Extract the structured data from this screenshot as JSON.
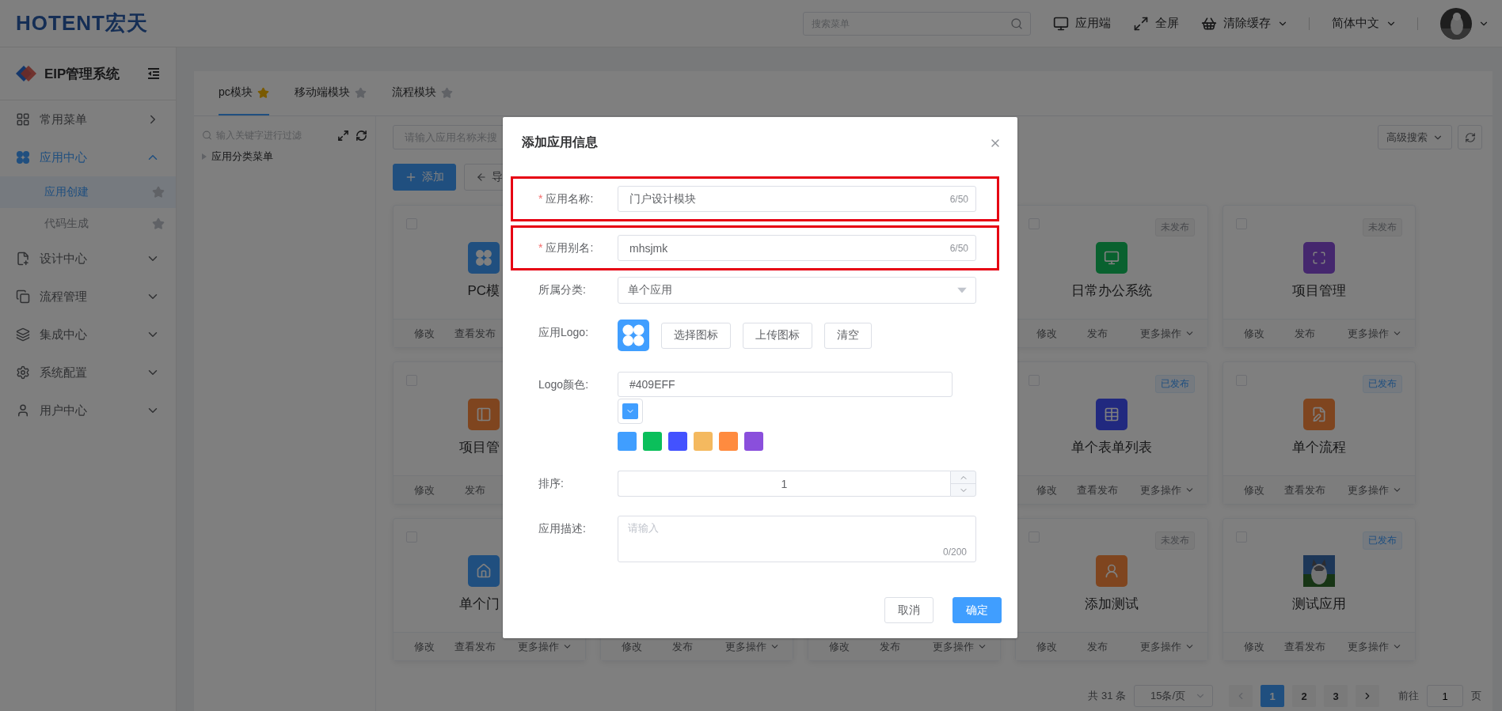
{
  "header": {
    "logo": "HOTENT宏天",
    "search": {
      "placeholder": "搜索菜单"
    },
    "actions": [
      {
        "label": "应用端",
        "dropdown": false
      },
      {
        "label": "全屏",
        "dropdown": false
      },
      {
        "label": "清除缓存",
        "dropdown": true
      }
    ],
    "language": "简体中文"
  },
  "sidebar": {
    "title": "EIP管理系统",
    "items": [
      {
        "label": "常用菜单",
        "kind": "flyout",
        "expanded": false
      },
      {
        "label": "应用中心",
        "kind": "group",
        "expanded": true,
        "children": [
          {
            "label": "应用创建",
            "selected": true
          },
          {
            "label": "代码生成",
            "selected": false
          }
        ]
      },
      {
        "label": "设计中心",
        "kind": "group",
        "expanded": false
      },
      {
        "label": "流程管理",
        "kind": "group",
        "expanded": false
      },
      {
        "label": "集成中心",
        "kind": "group",
        "expanded": false
      },
      {
        "label": "系统配置",
        "kind": "group",
        "expanded": false
      },
      {
        "label": "用户中心",
        "kind": "group",
        "expanded": false
      }
    ]
  },
  "tabs": [
    {
      "label": "pc模块",
      "selected": true,
      "starred": true
    },
    {
      "label": "移动端模块",
      "selected": false,
      "starred": false
    },
    {
      "label": "流程模块",
      "selected": false,
      "starred": false
    }
  ],
  "tree": {
    "filter_placeholder": "输入关键字进行过滤",
    "items": [
      {
        "label": "应用分类菜单",
        "expanded": false
      }
    ]
  },
  "toolbar": {
    "search_placeholder": "请输入应用名称来搜",
    "add_button": "添加",
    "import_button": "导",
    "advanced_search": "高级搜索"
  },
  "cards": [
    {
      "kind": "icon",
      "title": "PC模",
      "checked": false,
      "actions": [
        "修改",
        "查看发布"
      ]
    },
    {
      "kind": "icon",
      "title": "日常办公系统",
      "checked": false,
      "status": "未发布",
      "published": false,
      "actions": [
        "修改",
        "发布",
        "更多操作"
      ]
    },
    {
      "kind": "icon",
      "title": "项目管理",
      "checked": false,
      "status": "未发布",
      "published": false,
      "actions": [
        "修改",
        "发布",
        "更多操作"
      ]
    },
    {
      "kind": "icon",
      "title": "项目管",
      "checked": false,
      "actions": [
        "修改",
        "发布"
      ]
    },
    {
      "kind": "icon",
      "title": "单个表单列表",
      "checked": false,
      "status": "已发布",
      "published": true,
      "actions": [
        "修改",
        "查看发布",
        "更多操作"
      ]
    },
    {
      "kind": "icon",
      "title": "单个流程",
      "checked": false,
      "status": "已发布",
      "published": true,
      "actions": [
        "修改",
        "查看发布",
        "更多操作"
      ]
    },
    {
      "kind": "icon",
      "title": "单个门",
      "checked": false,
      "actions": [
        "修改",
        "查看发布",
        "更多操作"
      ]
    },
    {
      "kind": "covered",
      "actions": [
        "修改",
        "发布",
        "更多操作"
      ]
    },
    {
      "kind": "covered",
      "actions": [
        "修改",
        "发布",
        "更多操作"
      ]
    },
    {
      "kind": "icon",
      "title": "添加测试",
      "checked": false,
      "status": "未发布",
      "published": false,
      "actions": [
        "修改",
        "发布",
        "更多操作"
      ]
    },
    {
      "kind": "picture",
      "title": "测试应用",
      "checked": false,
      "status": "已发布",
      "published": true,
      "actions": [
        "修改",
        "查看发布",
        "更多操作"
      ]
    }
  ],
  "pagination": {
    "total": "共 31 条",
    "page_size": "15条/页",
    "pages": [
      {
        "label": "1",
        "selected": true
      },
      {
        "label": "2",
        "selected": false
      },
      {
        "label": "3",
        "selected": false
      }
    ],
    "goto_label": "前往",
    "goto_value": "1",
    "goto_suffix": "页"
  },
  "dialog": {
    "title": "添加应用信息",
    "rows": [
      {
        "kind": "text",
        "label": "应用名称:",
        "required_mark": "*",
        "highlighted": true,
        "value": "门户设计模块",
        "counter": "6/50"
      },
      {
        "kind": "text",
        "label": "应用别名:",
        "required_mark": "*",
        "highlighted": true,
        "value": "mhsjmk",
        "counter": "6/50"
      },
      {
        "kind": "select",
        "label": "所属分类:",
        "highlighted": false,
        "value": "单个应用"
      },
      {
        "kind": "logo",
        "label": "应用Logo:",
        "highlighted": false,
        "buttons": [
          "选择图标",
          "上传图标",
          "清空"
        ]
      },
      {
        "kind": "color",
        "label": "Logo颜色:",
        "highlighted": false,
        "value": "#409EFF",
        "swatches": [
          {
            "color": "#409eff"
          },
          {
            "color": "#0bbf5b"
          },
          {
            "color": "#4352ff"
          },
          {
            "color": "#f4b95f"
          },
          {
            "color": "#ff8b3f"
          },
          {
            "color": "#8a4fdc"
          }
        ]
      },
      {
        "kind": "number",
        "label": "排序:",
        "highlighted": false,
        "value": "1"
      },
      {
        "kind": "textarea",
        "label": "应用描述:",
        "highlighted": false,
        "placeholder": "请输入",
        "counter": "0/200"
      }
    ],
    "buttons": [
      {
        "label": "取消",
        "kind": "default"
      },
      {
        "label": "确定",
        "kind": "primary"
      }
    ]
  }
}
